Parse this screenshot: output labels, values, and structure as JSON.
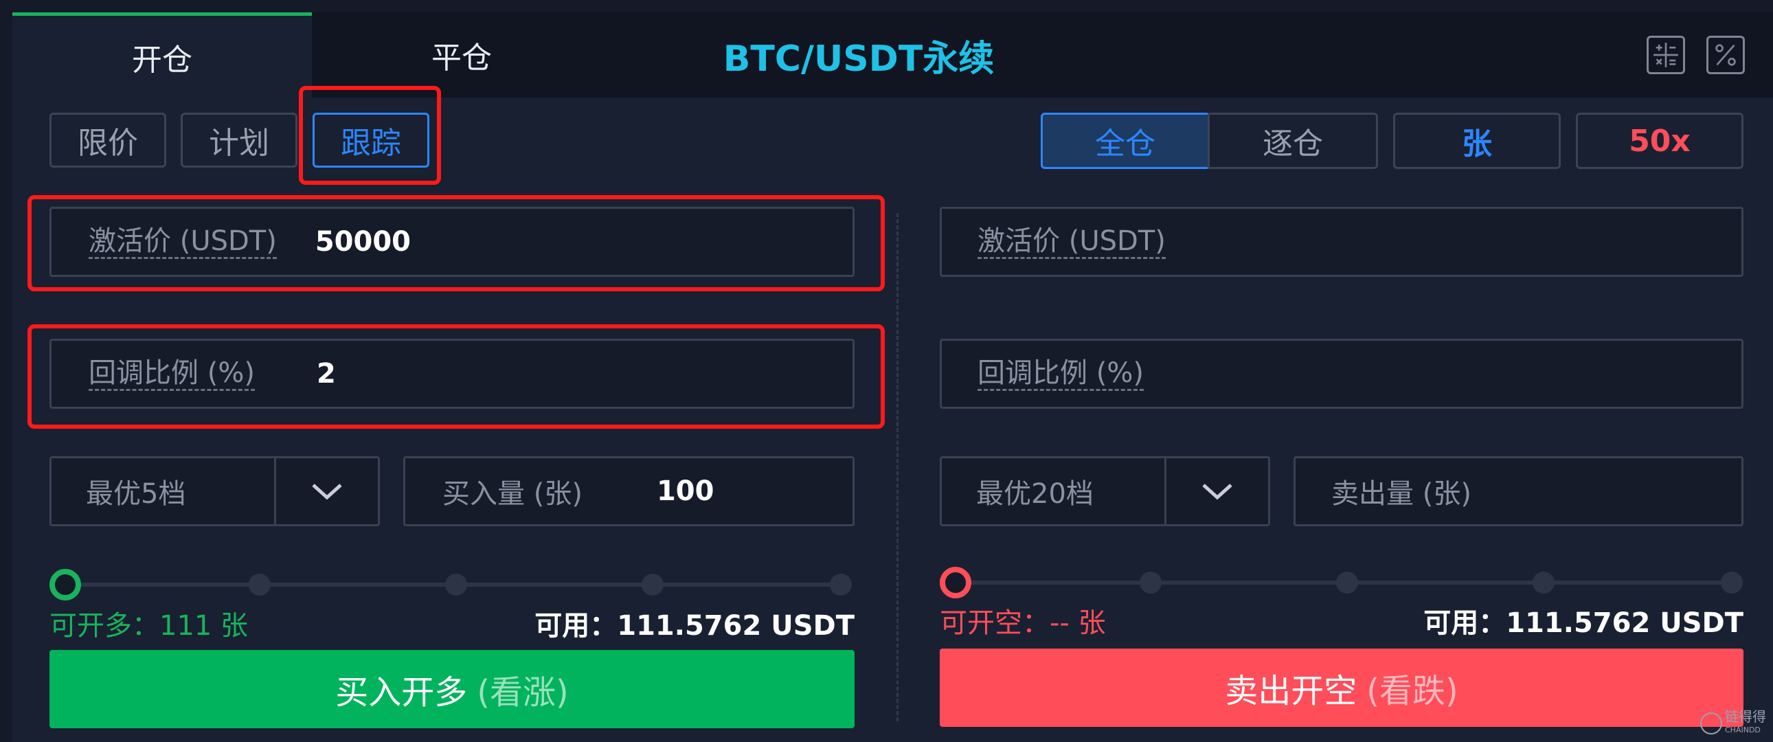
{
  "header": {
    "tabs": [
      {
        "label": "开仓",
        "active": true
      },
      {
        "label": "平仓",
        "active": false
      }
    ],
    "title": "BTC/USDT永续",
    "icons": [
      "calculator-icon",
      "percent-icon"
    ]
  },
  "order_types": [
    "限价",
    "计划",
    "跟踪"
  ],
  "selected_order_type": "跟踪",
  "margin_mode": {
    "options": [
      "全仓",
      "逐仓"
    ],
    "selected": "全仓"
  },
  "unit": "张",
  "leverage": "50x",
  "buy": {
    "activation_label": "激活价 (USDT)",
    "activation_value": "50000",
    "callback_label": "回调比例 (%)",
    "callback_value": "2",
    "price_level": "最优5档",
    "amount_label": "买入量 (张)",
    "amount_value": "100",
    "available_open": "可开多：111 张",
    "available_balance": "可用：111.5762 USDT",
    "action_label": "买入开多",
    "action_hint": "(看涨)"
  },
  "sell": {
    "activation_label": "激活价 (USDT)",
    "activation_value": "",
    "callback_label": "回调比例 (%)",
    "callback_value": "",
    "price_level": "最优20档",
    "amount_label": "卖出量 (张)",
    "amount_value": "",
    "available_open": "可开空：-- 张",
    "available_balance": "可用：111.5762 USDT",
    "action_label": "卖出开空",
    "action_hint": "(看跌)"
  },
  "watermark": {
    "text": "链得得",
    "subtext": "CHAINDD"
  },
  "colors": {
    "accent_blue": "#2d86ff",
    "buy_green": "#00b35c",
    "sell_red": "#ff4d5a",
    "title_cyan": "#1fc1e6",
    "highlight_red": "#ff1a1a"
  }
}
